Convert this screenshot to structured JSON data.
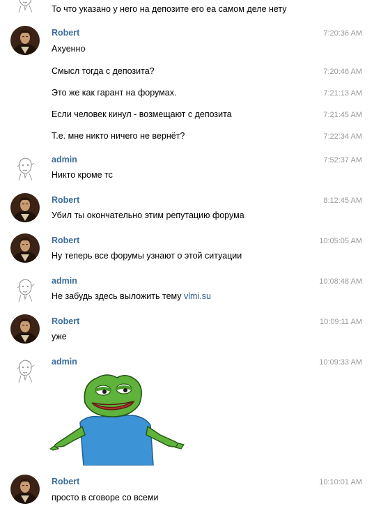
{
  "colors": {
    "author_name": "#3a6d99",
    "timestamp": "#999999",
    "link": "#2a5885",
    "message_text": "#000000",
    "background": "#ffffff"
  },
  "messages": [
    {
      "text": "То что указано у него на депозите его еа самом деле нету"
    },
    {
      "author": "Robert",
      "time": "7:20:36 AM",
      "text": "Ахуенно",
      "avatar_icon": "portrait-avatar-icon"
    },
    {
      "time": "7:20:46 AM",
      "text": "Смысл тогда с депозита?"
    },
    {
      "time": "7:21:13 AM",
      "text": "Это же как гарант на форумах."
    },
    {
      "time": "7:21:45 AM",
      "text": "Если человек кинул - возмещают с депозита"
    },
    {
      "time": "7:22:34 AM",
      "text": "Т.е. мне никто ничего не вернёт?"
    },
    {
      "author": "admin",
      "time": "7:52:37 AM",
      "text": "Никто кроме тс",
      "avatar_icon": "sketch-face-avatar-icon"
    },
    {
      "author": "Robert",
      "time": "8:12:45 AM",
      "text": "Убил ты окончательно этим репутацию форума"
    },
    {
      "author": "Robert",
      "time": "10:05:05 AM",
      "text": "Ну теперь все форумы узнают о этой ситуации"
    },
    {
      "author": "admin",
      "time": "10:08:48 AM",
      "text": "Не забудь здесь выложить тему ",
      "link": "vlmi.su"
    },
    {
      "author": "Robert",
      "time": "10:09:11 AM",
      "text": "уже"
    },
    {
      "author": "admin",
      "time": "10:09:33 AM",
      "sticker_icon": "pepe-frog-shrug-sticker-icon"
    },
    {
      "author": "Robert",
      "time": "10:10:01 AM",
      "text": "просто в сговоре со всеми"
    }
  ]
}
